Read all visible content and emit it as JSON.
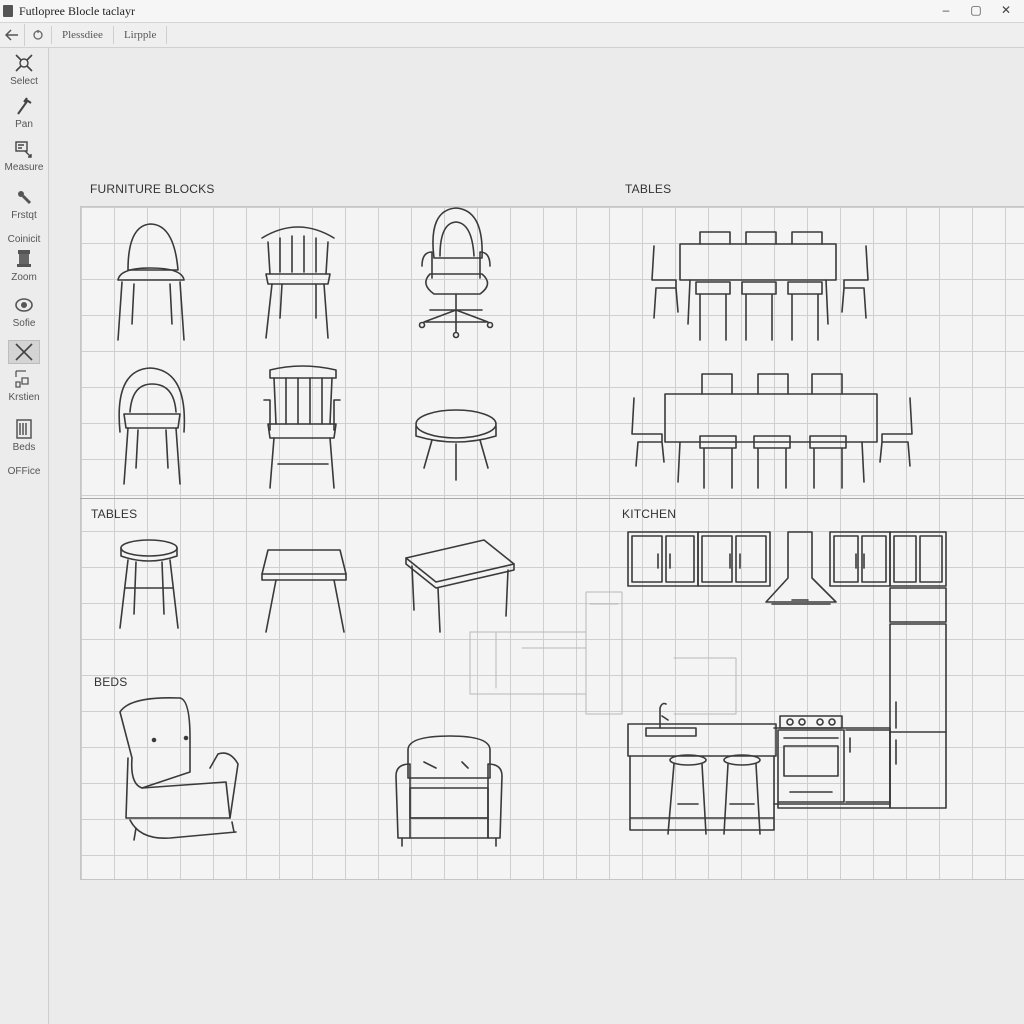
{
  "window": {
    "title": "Futlopree Blocle taclayr",
    "controls": [
      "–",
      "▢",
      "✕"
    ]
  },
  "toolbar": {
    "back_icon": "arrow-left-icon",
    "sync_icon": "refresh-icon",
    "tabs": [
      "Plessdiee",
      "Lirpple"
    ]
  },
  "tools": [
    {
      "label": "Select",
      "icon": "select-icon"
    },
    {
      "label": "Pan",
      "icon": "pan-icon"
    },
    {
      "label": "Measure",
      "icon": "measure-icon"
    },
    {
      "label": "Frstqt",
      "icon": "pen-icon"
    },
    {
      "label": "Coinicit",
      "icon": ""
    },
    {
      "label": "Zoom",
      "icon": "zoom-icon"
    },
    {
      "label": "Sofie",
      "icon": "eye-icon"
    },
    {
      "label": "",
      "icon": "cross-icon",
      "active": true
    },
    {
      "label": "Krstien",
      "icon": "grid-icon"
    },
    {
      "label": "Beds",
      "icon": "bed-icon"
    },
    {
      "label": "OFFice",
      "icon": ""
    }
  ],
  "sections": {
    "furniture_blocks": "FURNITURE BLOCKS",
    "tables_top": "TABLES",
    "tables_bottom": "TABLES",
    "kitchen": "KITCHEN",
    "beds": "BEDS"
  }
}
